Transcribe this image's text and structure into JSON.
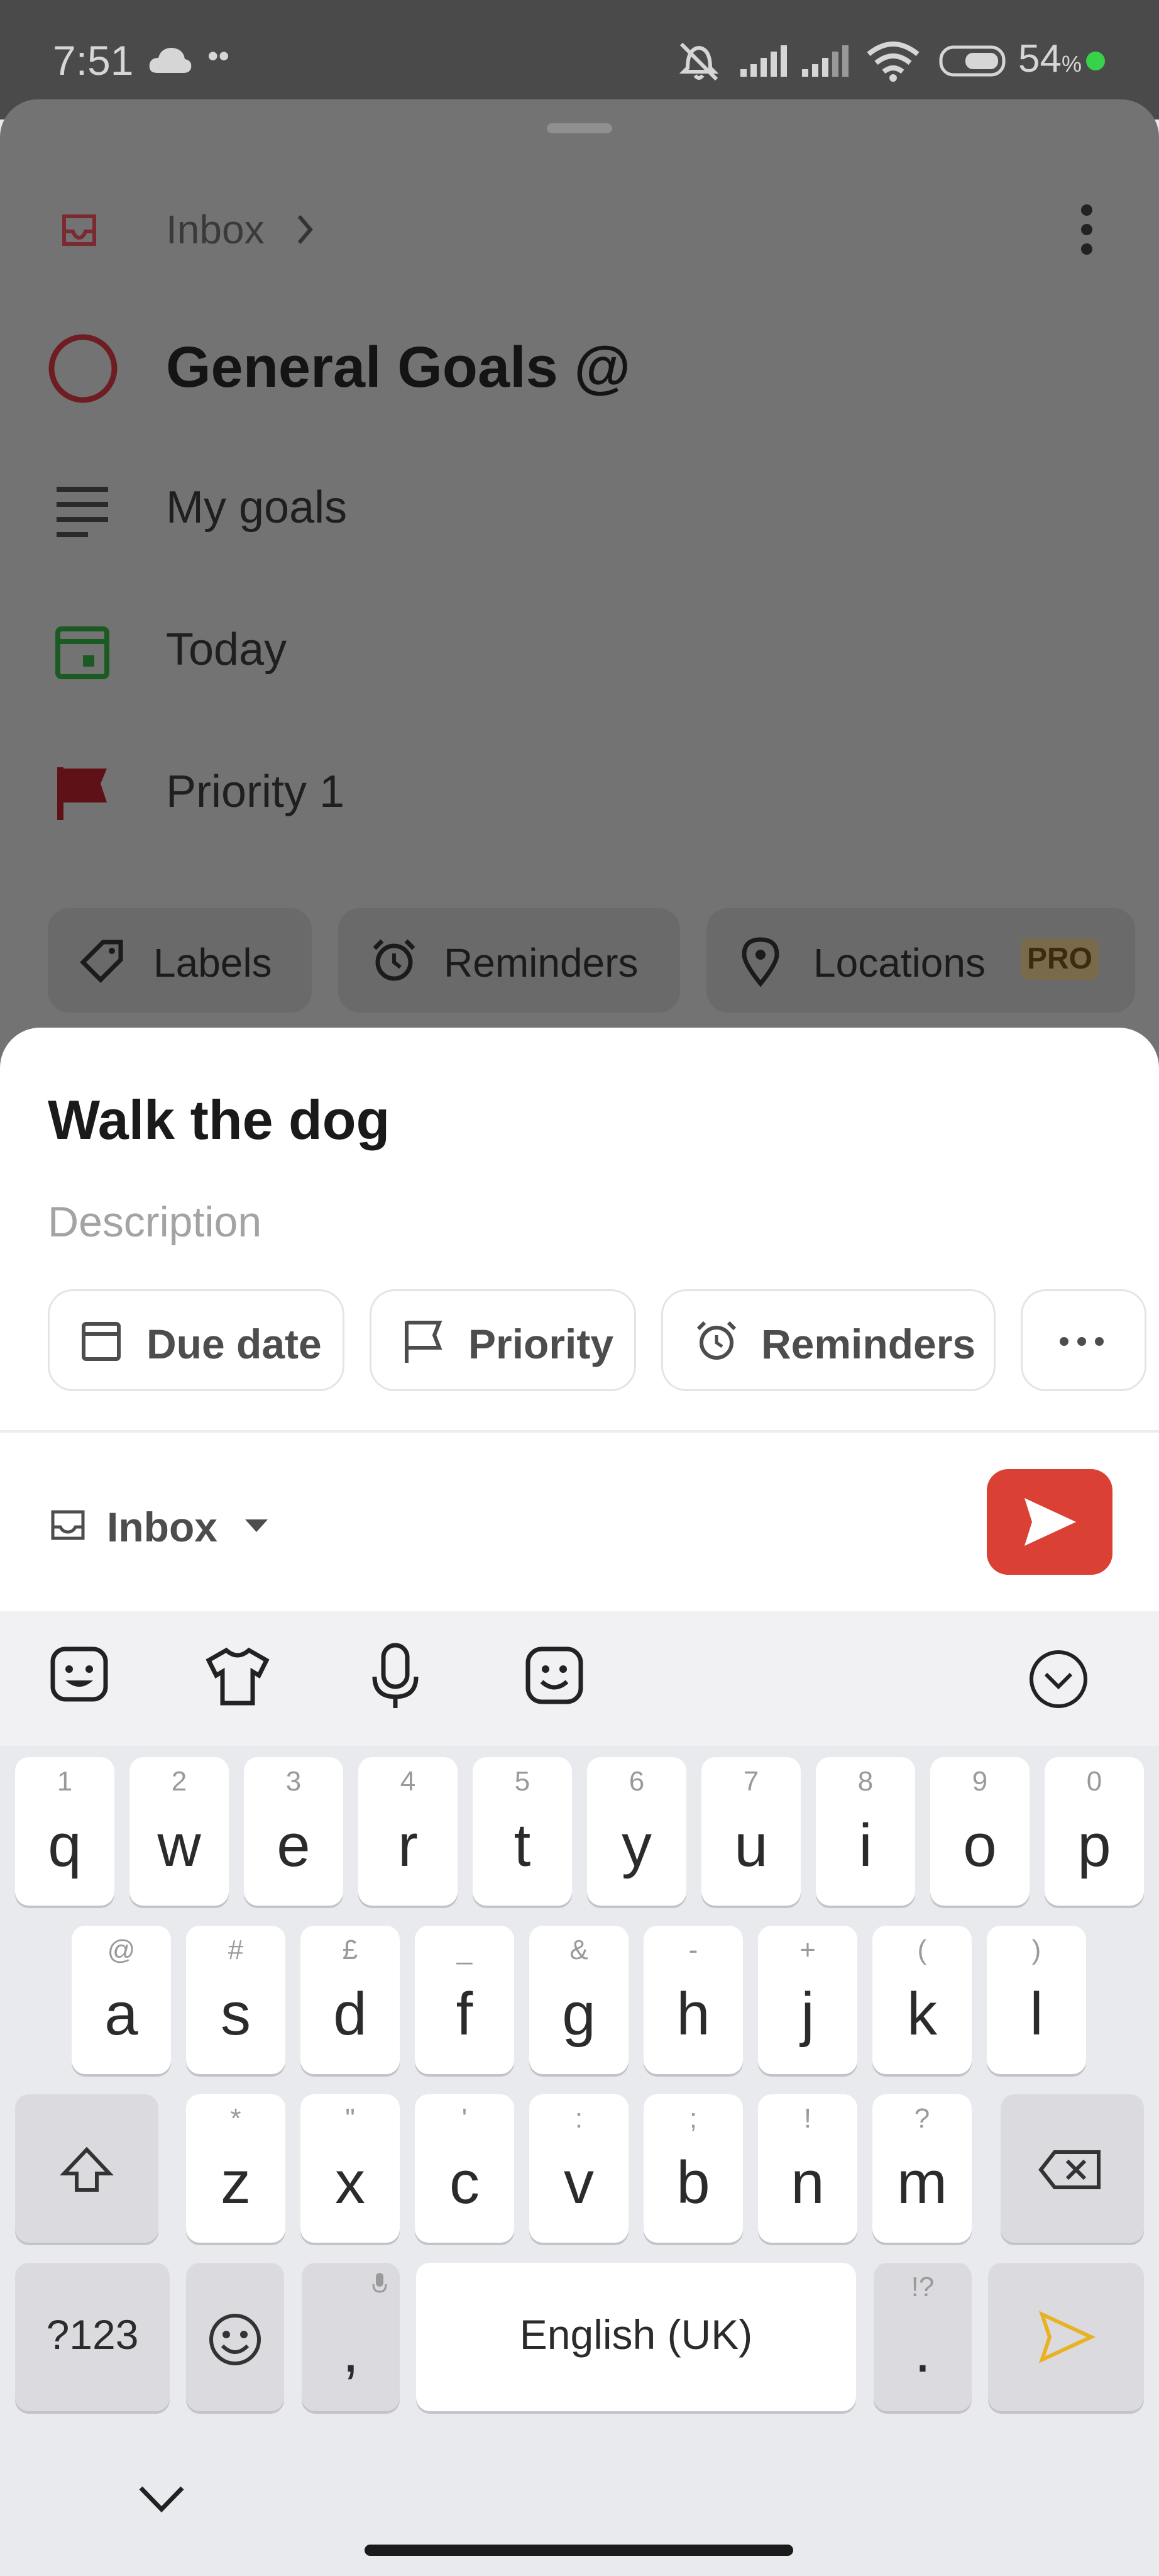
{
  "status_bar": {
    "time": "7:51",
    "battery": "54",
    "battery_unit": "%"
  },
  "task_detail": {
    "project": "Inbox",
    "title": "General Goals @",
    "description": "My goals",
    "date": "Today",
    "priority": "Priority 1",
    "chips": {
      "labels": "Labels",
      "reminders": "Reminders",
      "locations": "Locations",
      "pro_badge": "PRO"
    }
  },
  "quick_add": {
    "task_name": "Walk the dog",
    "description_placeholder": "Description",
    "chips": {
      "due_date": "Due date",
      "priority": "Priority",
      "reminders": "Reminders"
    },
    "project": "Inbox"
  },
  "keyboard": {
    "row1": [
      {
        "k": "q",
        "h": "1"
      },
      {
        "k": "w",
        "h": "2"
      },
      {
        "k": "e",
        "h": "3"
      },
      {
        "k": "r",
        "h": "4"
      },
      {
        "k": "t",
        "h": "5"
      },
      {
        "k": "y",
        "h": "6"
      },
      {
        "k": "u",
        "h": "7"
      },
      {
        "k": "i",
        "h": "8"
      },
      {
        "k": "o",
        "h": "9"
      },
      {
        "k": "p",
        "h": "0"
      }
    ],
    "row2": [
      {
        "k": "a",
        "h": "@"
      },
      {
        "k": "s",
        "h": "#"
      },
      {
        "k": "d",
        "h": "£"
      },
      {
        "k": "f",
        "h": "_"
      },
      {
        "k": "g",
        "h": "&"
      },
      {
        "k": "h",
        "h": "-"
      },
      {
        "k": "j",
        "h": "+"
      },
      {
        "k": "k",
        "h": "("
      },
      {
        "k": "l",
        "h": ")"
      }
    ],
    "row3": [
      {
        "k": "z",
        "h": "*"
      },
      {
        "k": "x",
        "h": "\""
      },
      {
        "k": "c",
        "h": "'"
      },
      {
        "k": "v",
        "h": ":"
      },
      {
        "k": "b",
        "h": ";"
      },
      {
        "k": "n",
        "h": "!"
      },
      {
        "k": "m",
        "h": "?"
      }
    ],
    "symbols_key": "?123",
    "comma": ",",
    "space": "English (UK)",
    "period": ".",
    "period_hint": "!?"
  }
}
